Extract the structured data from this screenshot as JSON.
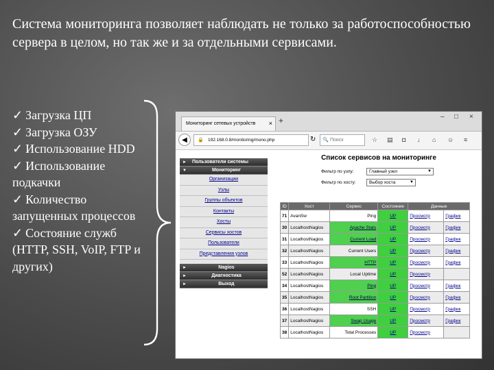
{
  "slide": {
    "title": "Система мониторинга позволяет наблюдать не только за работоспособностью сервера в целом, но так же и за отдельными сервисами.",
    "check_glyph": "✓",
    "bullets": [
      "Загрузка ЦП",
      "Загрузка ОЗУ",
      "Использование HDD",
      "Использование подкачки",
      "Количество запущенных процессов",
      "Состояние служб (HTTP, SSH, VoIP, FTP и других)"
    ]
  },
  "browser": {
    "tab_title": "Мониторинг сетевых устройств",
    "tab_close": "×",
    "new_tab": "+",
    "window_controls": [
      "–",
      "□",
      "×"
    ],
    "back": "◀",
    "url": "192.168.0.8/monitoring/mono.php",
    "search_placeholder": "Поиск",
    "icons": [
      "star-icon",
      "bookmark-icon",
      "download-icon",
      "home-icon",
      "chat-icon",
      "menu-icon"
    ]
  },
  "sidebar": {
    "sections": [
      {
        "label": "Пользователи системы",
        "arrow": "►"
      },
      {
        "label": "Мониторинг",
        "arrow": "▼"
      }
    ],
    "items": [
      "Организации",
      "Узлы",
      "Группы объектов",
      "Контакты",
      "Хосты",
      "Сервисы хостов",
      "Пользователи",
      "Представления узлов"
    ],
    "bottom_sections": [
      {
        "label": "Nagios",
        "arrow": "►"
      },
      {
        "label": "Диагностика",
        "arrow": "►"
      },
      {
        "label": "Выход",
        "arrow": "►"
      }
    ]
  },
  "content": {
    "title": "Список сервисов на мониторинге",
    "filter_node_label": "Фильтр по узлу:",
    "filter_node_value": "Главный узел",
    "filter_host_label": "Фильтр по хосту:",
    "filter_host_value": "Выбор хоста",
    "table": {
      "headers": [
        "ID",
        "Хост",
        "Сервис",
        "Состояние",
        "Данные"
      ],
      "rows": [
        {
          "id": "71",
          "host": "AvanSw",
          "service": "Ping",
          "state": "UP",
          "view": "Просмотр",
          "graph": "График",
          "green": false
        },
        {
          "id": "30",
          "host": "LocalhostNagios",
          "service": "Apache Stats",
          "state": "UP",
          "view": "Просмотр",
          "graph": "График",
          "green": true
        },
        {
          "id": "31",
          "host": "LocalhostNagios",
          "service": "Current Load",
          "state": "UP",
          "view": "Просмотр",
          "graph": "График",
          "green": true
        },
        {
          "id": "32",
          "host": "LocalhostNagios",
          "service": "Current Users",
          "state": "UP",
          "view": "Просмотр",
          "graph": "График",
          "green": false
        },
        {
          "id": "33",
          "host": "LocalhostNagios",
          "service": "HTTP",
          "state": "UP",
          "view": "Просмотр",
          "graph": "График",
          "green": true
        },
        {
          "id": "52",
          "host": "LocalhostNagios",
          "service": "Local Uptime",
          "state": "UP",
          "view": "Просмотр",
          "graph": "",
          "green": false
        },
        {
          "id": "34",
          "host": "LocalhostNagios",
          "service": "Ping",
          "state": "UP",
          "view": "Просмотр",
          "graph": "График",
          "green": true
        },
        {
          "id": "35",
          "host": "LocalhostNagios",
          "service": "Root Partition",
          "state": "UP",
          "view": "Просмотр",
          "graph": "График",
          "green": true
        },
        {
          "id": "36",
          "host": "LocalhostNagios",
          "service": "SSH",
          "state": "UP",
          "view": "Просмотр",
          "graph": "График",
          "green": false
        },
        {
          "id": "37",
          "host": "LocalhostNagios",
          "service": "Swap Usage",
          "state": "UP",
          "view": "Просмотр",
          "graph": "График",
          "green": true
        },
        {
          "id": "38",
          "host": "LocalhostNagios",
          "service": "Total Processes",
          "state": "UP",
          "view": "Просмотр",
          "graph": "",
          "green": false
        }
      ]
    }
  }
}
